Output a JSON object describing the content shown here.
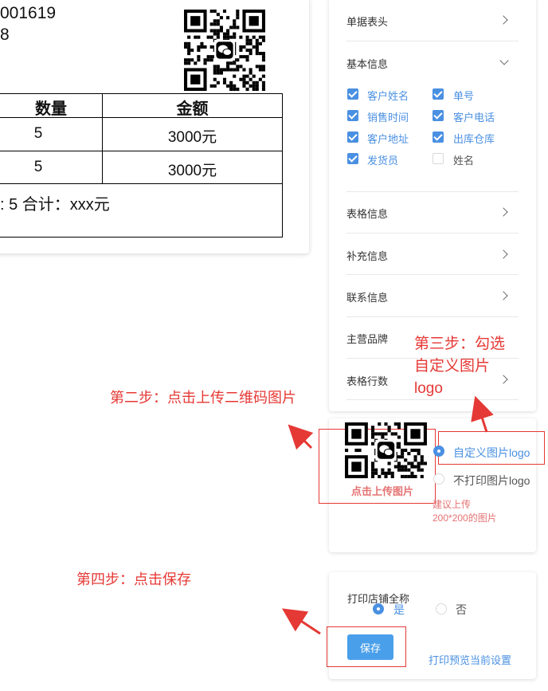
{
  "document": {
    "order_number_fragment": "001619",
    "line2_fragment": "8",
    "table": {
      "headers": [
        "数量",
        "金额"
      ],
      "rows": [
        [
          "5",
          "3000元"
        ],
        [
          "5",
          "3000元"
        ]
      ],
      "summary": ": 5 合计：xxx元"
    }
  },
  "settings_panel": {
    "sections": [
      {
        "label": "单据表头",
        "state": "collapsed"
      },
      {
        "label": "基本信息",
        "state": "expanded"
      },
      {
        "label": "表格信息",
        "state": "collapsed"
      },
      {
        "label": "补充信息",
        "state": "collapsed"
      },
      {
        "label": "联系信息",
        "state": "collapsed"
      },
      {
        "label": "主营品牌",
        "state": "none"
      },
      {
        "label": "表格行数",
        "state": "collapsed"
      }
    ],
    "basic_info_checkboxes": [
      {
        "label": "客户姓名",
        "checked": true
      },
      {
        "label": "单号",
        "checked": true
      },
      {
        "label": "销售时间",
        "checked": true
      },
      {
        "label": "客户电话",
        "checked": true
      },
      {
        "label": "客户地址",
        "checked": true
      },
      {
        "label": "出库仓库",
        "checked": true
      },
      {
        "label": "发货员",
        "checked": true
      },
      {
        "label": "姓名",
        "checked": false
      }
    ]
  },
  "logo_panel": {
    "upload_label": "点击上传图片",
    "option_custom": "自定义图片logo",
    "option_none": "不打印图片logo",
    "hint": "建议上传\n200*200的图片",
    "hint_line1": "建议上传",
    "hint_line2": "200*200的图片",
    "selected": "custom"
  },
  "store_panel": {
    "label": "打印店铺全称",
    "option_yes": "是",
    "option_no": "否",
    "selected": "yes",
    "save_label": "保存",
    "preview_label": "打印预览当前设置"
  },
  "annotations": {
    "step2": "第二步：点击上传二维码图片",
    "step3_line1": "第三步：勾选",
    "step3_line2": "自定义图片",
    "step3_line3": "logo",
    "step4": "第四步：点击保存"
  },
  "colors": {
    "accent": "#4a90e2",
    "annotation_red": "#e53935",
    "save_button": "#4a9fea"
  },
  "icons": [
    "qr-code-icon",
    "wechat-icon",
    "chevron-right-icon",
    "chevron-down-icon",
    "arrow-icon"
  ]
}
